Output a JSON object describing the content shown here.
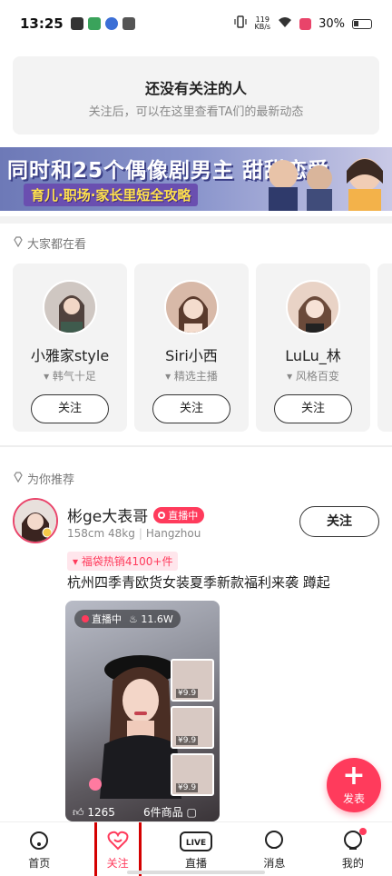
{
  "status_bar": {
    "time": "13:25",
    "net_speed": "119",
    "net_unit": "KB/s",
    "battery": "30%"
  },
  "empty_follow": {
    "title": "还没有关注的人",
    "subtitle": "关注后，可以在这里查看TA们的最新动态"
  },
  "banner": {
    "headline": "同时和25个偶像剧男主 甜甜恋爱",
    "subline": "育儿·职场·家长里短全攻略"
  },
  "popular": {
    "heading": "大家都在看",
    "cards": [
      {
        "name": "小雅家style",
        "tag": "韩气十足",
        "button": "关注"
      },
      {
        "name": "Siri小西",
        "tag": "精选主播",
        "button": "关注"
      },
      {
        "name": "LuLu_林",
        "tag": "风格百变",
        "button": "关注"
      }
    ]
  },
  "recommend": {
    "heading": "为你推荐",
    "user": {
      "name": "彬ge大表哥",
      "live_badge": "直播中",
      "height_weight": "158cm 48kg",
      "city": "Hangzhou",
      "follow_button": "关注",
      "promo": "福袋热销4100+件",
      "title": "杭州四季青欧货女装夏季新款福利来袭 蹲起"
    },
    "video": {
      "status": "直播中",
      "views": "11.6W",
      "likes": "1265",
      "goods": "6件商品",
      "products": [
        "¥9.9",
        "¥9.9",
        "¥9.9"
      ]
    }
  },
  "fab": {
    "label": "发表",
    "icon": "plus-icon"
  },
  "bottom_nav": [
    {
      "label": "首页",
      "icon": "home-icon"
    },
    {
      "label": "关注",
      "icon": "heart-icon"
    },
    {
      "label": "直播",
      "icon": "live-icon"
    },
    {
      "label": "消息",
      "icon": "message-icon"
    },
    {
      "label": "我的",
      "icon": "profile-icon"
    }
  ],
  "colors": {
    "accent": "#ff3b5c",
    "highlight_frame": "#d40000"
  }
}
